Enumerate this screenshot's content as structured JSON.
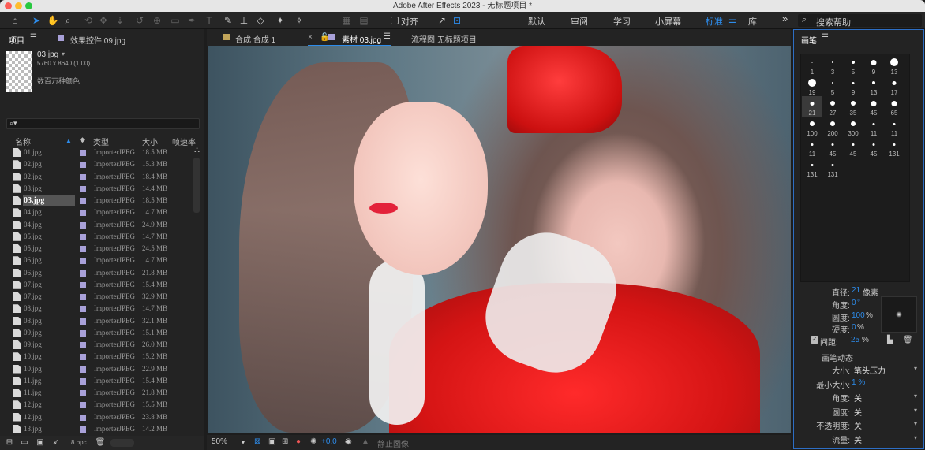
{
  "window": {
    "title": "Adobe After Effects 2023 - 无标题项目 *"
  },
  "toolbar": {
    "align_label": "对齐",
    "workspaces": [
      {
        "label": "默认",
        "active": false
      },
      {
        "label": "审阅",
        "active": false
      },
      {
        "label": "学习",
        "active": false
      },
      {
        "label": "小屏幕",
        "active": false
      },
      {
        "label": "标准",
        "active": true
      },
      {
        "label": "库",
        "active": false
      }
    ],
    "expand_glyph": "»",
    "search_placeholder": "搜索帮助"
  },
  "project_panel": {
    "tab_label": "项目",
    "effects_tab_label": "效果控件 09.jpg",
    "selected_name": "03.jpg",
    "selected_dims": "5760 x 8640 (1.00)",
    "selected_color": "数百万种颜色",
    "columns": {
      "name": "名称",
      "type": "类型",
      "size": "大小",
      "fps": "帧速率"
    },
    "items": [
      {
        "name": "01.jpg",
        "type": "ImporterJPEG",
        "size": "18.5 MB"
      },
      {
        "name": "02.jpg",
        "type": "ImporterJPEG",
        "size": "15.3 MB"
      },
      {
        "name": "02.jpg",
        "type": "ImporterJPEG",
        "size": "18.4 MB"
      },
      {
        "name": "03.jpg",
        "type": "ImporterJPEG",
        "size": "14.4 MB"
      },
      {
        "name": "03.jpg",
        "type": "ImporterJPEG",
        "size": "18.5 MB",
        "selected": true
      },
      {
        "name": "04.jpg",
        "type": "ImporterJPEG",
        "size": "14.7 MB"
      },
      {
        "name": "04.jpg",
        "type": "ImporterJPEG",
        "size": "24.9 MB"
      },
      {
        "name": "05.jpg",
        "type": "ImporterJPEG",
        "size": "14.7 MB"
      },
      {
        "name": "05.jpg",
        "type": "ImporterJPEG",
        "size": "24.5 MB"
      },
      {
        "name": "06.jpg",
        "type": "ImporterJPEG",
        "size": "14.7 MB"
      },
      {
        "name": "06.jpg",
        "type": "ImporterJPEG",
        "size": "21.8 MB"
      },
      {
        "name": "07.jpg",
        "type": "ImporterJPEG",
        "size": "15.4 MB"
      },
      {
        "name": "07.jpg",
        "type": "ImporterJPEG",
        "size": "32.9 MB"
      },
      {
        "name": "08.jpg",
        "type": "ImporterJPEG",
        "size": "14.7 MB"
      },
      {
        "name": "08.jpg",
        "type": "ImporterJPEG",
        "size": "32.1 MB"
      },
      {
        "name": "09.jpg",
        "type": "ImporterJPEG",
        "size": "15.1 MB"
      },
      {
        "name": "09.jpg",
        "type": "ImporterJPEG",
        "size": "26.0 MB"
      },
      {
        "name": "10.jpg",
        "type": "ImporterJPEG",
        "size": "15.2 MB"
      },
      {
        "name": "10.jpg",
        "type": "ImporterJPEG",
        "size": "22.9 MB"
      },
      {
        "name": "11.jpg",
        "type": "ImporterJPEG",
        "size": "15.4 MB"
      },
      {
        "name": "11.jpg",
        "type": "ImporterJPEG",
        "size": "21.8 MB"
      },
      {
        "name": "12.jpg",
        "type": "ImporterJPEG",
        "size": "15.5 MB"
      },
      {
        "name": "12.jpg",
        "type": "ImporterJPEG",
        "size": "23.8 MB"
      },
      {
        "name": "13.jpg",
        "type": "ImporterJPEG",
        "size": "14.2 MB"
      }
    ],
    "bpc_label": "8 bpc"
  },
  "viewer": {
    "tabs": [
      {
        "label": "合成 合成 1"
      },
      {
        "label": "素材 03.jpg",
        "active": true
      },
      {
        "label": "流程图 无标题项目"
      }
    ],
    "zoom": "50%",
    "exposure": "+0.0",
    "still_label": "静止图像"
  },
  "brush_panel": {
    "tab_label": "画笔",
    "brushes": [
      {
        "size": "1",
        "d": 1
      },
      {
        "size": "3",
        "d": 2
      },
      {
        "size": "5",
        "d": 4
      },
      {
        "size": "9",
        "d": 7
      },
      {
        "size": "13",
        "d": 10
      },
      {
        "size": "19",
        "d": 10
      },
      {
        "size": "5",
        "d": 2
      },
      {
        "size": "9",
        "d": 3
      },
      {
        "size": "13",
        "d": 4
      },
      {
        "size": "17",
        "d": 5
      },
      {
        "size": "21",
        "d": 5,
        "selected": true
      },
      {
        "size": "27",
        "d": 6
      },
      {
        "size": "35",
        "d": 6
      },
      {
        "size": "45",
        "d": 7
      },
      {
        "size": "65",
        "d": 7
      },
      {
        "size": "100",
        "d": 6
      },
      {
        "size": "200",
        "d": 6
      },
      {
        "size": "300",
        "d": 6
      },
      {
        "size": "11",
        "d": 3
      },
      {
        "size": "11",
        "d": 3
      },
      {
        "size": "11",
        "d": 3
      },
      {
        "size": "45",
        "d": 3
      },
      {
        "size": "45",
        "d": 3
      },
      {
        "size": "45",
        "d": 3
      },
      {
        "size": "131",
        "d": 3
      },
      {
        "size": "131",
        "d": 3
      },
      {
        "size": "131",
        "d": 3
      }
    ],
    "diameter_label": "直径:",
    "diameter_value": "21",
    "diameter_unit": "像素",
    "angle_label": "角度:",
    "angle_value": "0",
    "angle_unit": "°",
    "roundness_label": "圆度:",
    "roundness_value": "100",
    "roundness_unit": "%",
    "hardness_label": "硬度:",
    "hardness_value": "0",
    "hardness_unit": "%",
    "spacing_label": "间距:",
    "spacing_value": "25",
    "spacing_unit": "%",
    "dynamics_label": "画笔动态",
    "dynamics": [
      {
        "label": "大小:",
        "value": "笔头压力"
      },
      {
        "label": "最小大小:",
        "value": "1 %",
        "is_number": true
      },
      {
        "label": "角度:",
        "value": "关"
      },
      {
        "label": "圆度:",
        "value": "关"
      },
      {
        "label": "不透明度:",
        "value": "关"
      },
      {
        "label": "流量:",
        "value": "关"
      }
    ]
  },
  "colors": {
    "accent": "#2d8ceb",
    "label_lavender": "#a8a0d8",
    "panel_border": "#2d6ec4"
  }
}
